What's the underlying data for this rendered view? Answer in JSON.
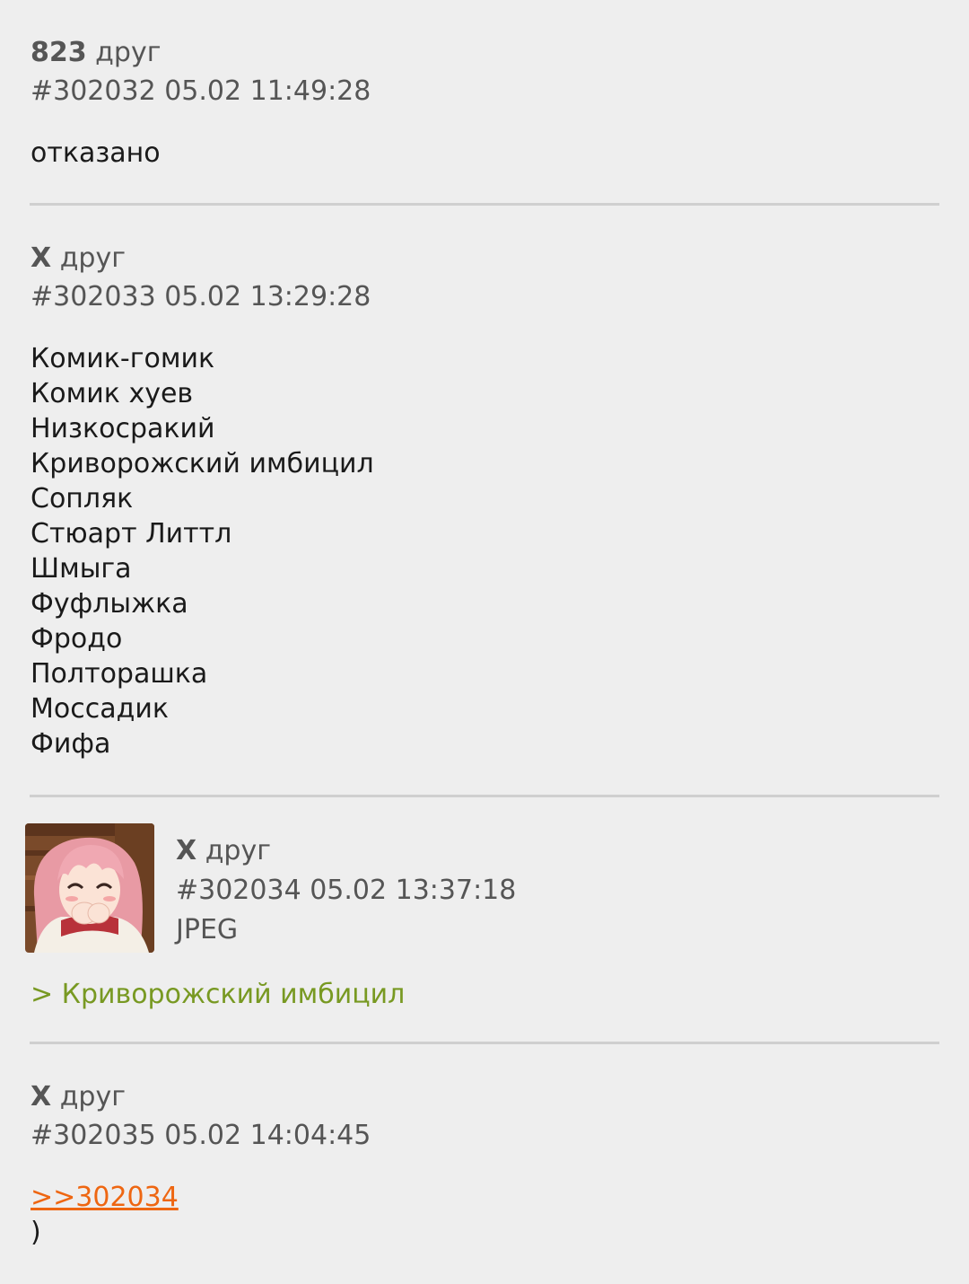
{
  "posts": [
    {
      "name": "823",
      "tag": "друг",
      "meta": "#302032 05.02 11:49:28",
      "lines": [
        "отказано"
      ]
    },
    {
      "name": "X",
      "tag": "друг",
      "meta": "#302033 05.02 13:29:28",
      "lines": [
        "Комик-гомик",
        "Комик хуев",
        "Низкосракий",
        "Криворожский имбицил",
        "Сопляк",
        "Стюарт Литтл",
        "Шмыга",
        "Фуфлыжка",
        "Фродо",
        "Полторашка",
        "Моссадик",
        "Фифа"
      ]
    },
    {
      "name": "X",
      "tag": "друг",
      "meta": "#302034 05.02 13:37:18",
      "file_type": "JPEG",
      "greentext": "> Криворожский имбицил"
    },
    {
      "name": "X",
      "tag": "друг",
      "meta": "#302035 05.02 14:04:45",
      "reply_link": ">>302034",
      "text": ")"
    }
  ],
  "colors": {
    "background": "#eeeeee",
    "meta_text": "#555555",
    "body_text": "#1a1a1a",
    "greentext": "#789922",
    "reply_link": "#ee6611",
    "divider": "#cfcfcf"
  }
}
